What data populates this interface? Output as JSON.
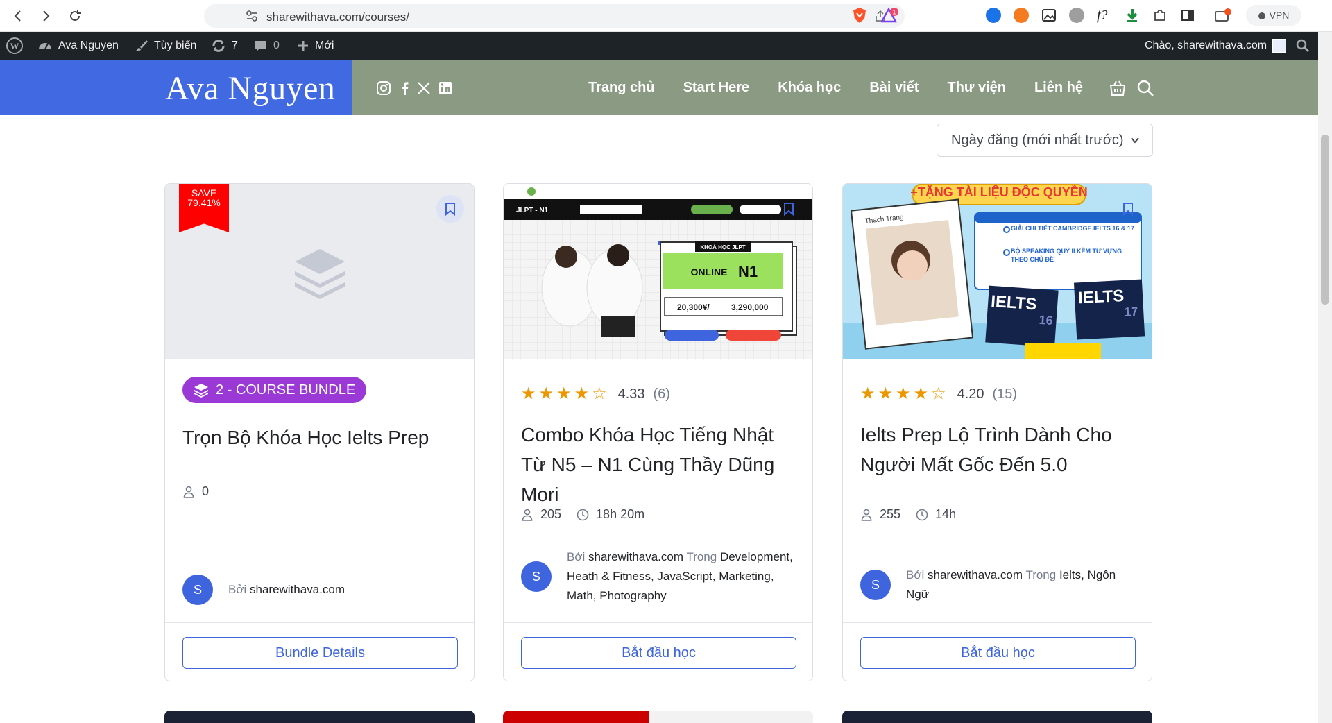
{
  "browser": {
    "url": "sharewithava.com/courses/",
    "vpn_label": "VPN",
    "badge_count": "1"
  },
  "admin_bar": {
    "site_name": "Ava Nguyen",
    "customize": "Tùy biến",
    "updates": "7",
    "comments": "0",
    "new": "Mới",
    "greeting": "Chào, sharewithava.com"
  },
  "header": {
    "logo": "Ava Nguyen",
    "menu": [
      "Trang chủ",
      "Start Here",
      "Khóa học",
      "Bài viết",
      "Thư viện",
      "Liên hệ"
    ],
    "colors": {
      "logo_bg": "#4169e1",
      "nav_bg": "#8a9a83"
    }
  },
  "sort": {
    "selected": "Ngày đăng (mới nhất trước)"
  },
  "cards": [
    {
      "save_label": "SAVE",
      "save_value": "79.41%",
      "badge": "2  - COURSE BUNDLE",
      "title": "Trọn Bộ Khóa Học Ielts Prep",
      "students": "0",
      "by": "Bởi",
      "author": "sharewithava.com",
      "avatar": "S",
      "cta": "Bundle Details"
    },
    {
      "rating": "4.33",
      "rating_stars": 4.33,
      "reviews": "(6)",
      "title": "Combo Khóa Học Tiếng Nhật Từ N5 – N1 Cùng Thầy Dũng Mori",
      "students": "205",
      "duration": "18h 20m",
      "by": "Bởi",
      "author": "sharewithava.com",
      "in": "Trong",
      "categories": "Development, Heath & Fitness, JavaScript, Marketing, Math, Photography",
      "avatar": "S",
      "cta": "Bắt đầu học",
      "thumb": {
        "level": "JLPT - N1",
        "tag": "KHOÁ HỌC JLPT",
        "online": "ONLINE",
        "n1": "N1",
        "price_jpy": "20,300¥/",
        "price_vnd": "3,290,000"
      }
    },
    {
      "rating": "4.20",
      "rating_stars": 4.2,
      "reviews": "(15)",
      "title": "Ielts Prep Lộ Trình Dành Cho Người Mất Gốc Đến 5.0",
      "students": "255",
      "duration": "14h",
      "by": "Bởi",
      "author": "sharewithava.com",
      "in": "Trong",
      "categories": "Ielts, Ngôn Ngữ",
      "avatar": "S",
      "cta": "Bắt đầu học",
      "thumb": {
        "banner": "+TẶNG TÀI LIỆU ĐỘC QUYỀN",
        "name": "Thạch Trang",
        "point1": "GIẢI CHI TIẾT CAMBRIDGE IELTS 16 & 17",
        "point2": "BỘ SPEAKING QUÝ II KÈM TỪ VỰNG THEO CHỦ ĐỀ",
        "book1": "IELTS",
        "book1_num": "16",
        "book2": "IELTS",
        "book2_num": "17"
      }
    }
  ]
}
